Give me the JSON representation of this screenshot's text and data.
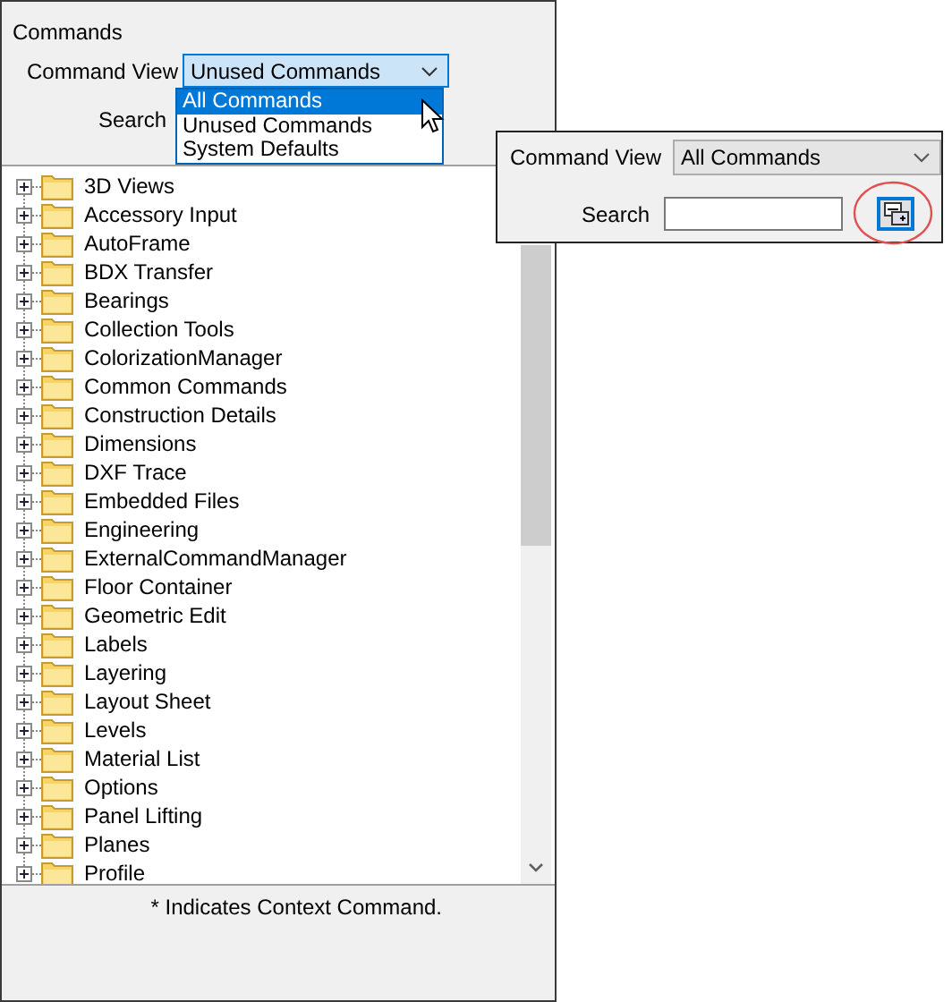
{
  "panel": {
    "title": "Commands"
  },
  "command_view": {
    "label": "Command View",
    "value": "Unused Commands",
    "expanded": true,
    "options": [
      {
        "label": "All Commands",
        "highlighted": true
      },
      {
        "label": "Unused Commands",
        "highlighted": false
      },
      {
        "label": "System Defaults",
        "highlighted": false
      }
    ]
  },
  "search": {
    "label": "Search"
  },
  "tree": {
    "items": [
      {
        "label": "3D Views"
      },
      {
        "label": "Accessory Input"
      },
      {
        "label": "AutoFrame"
      },
      {
        "label": "BDX Transfer"
      },
      {
        "label": "Bearings"
      },
      {
        "label": "Collection Tools"
      },
      {
        "label": "ColorizationManager"
      },
      {
        "label": "Common Commands"
      },
      {
        "label": "Construction Details"
      },
      {
        "label": "Dimensions"
      },
      {
        "label": "DXF Trace"
      },
      {
        "label": "Embedded Files"
      },
      {
        "label": "Engineering"
      },
      {
        "label": "ExternalCommandManager"
      },
      {
        "label": "Floor Container"
      },
      {
        "label": "Geometric Edit"
      },
      {
        "label": "Labels"
      },
      {
        "label": "Layering"
      },
      {
        "label": "Layout Sheet"
      },
      {
        "label": "Levels"
      },
      {
        "label": "Material List"
      },
      {
        "label": "Options"
      },
      {
        "label": "Panel Lifting"
      },
      {
        "label": "Planes"
      },
      {
        "label": "Profile"
      }
    ]
  },
  "footer": {
    "note": "* Indicates Context Command."
  },
  "inset": {
    "command_view": {
      "label": "Command View",
      "value": "All Commands"
    },
    "search": {
      "label": "Search"
    }
  }
}
